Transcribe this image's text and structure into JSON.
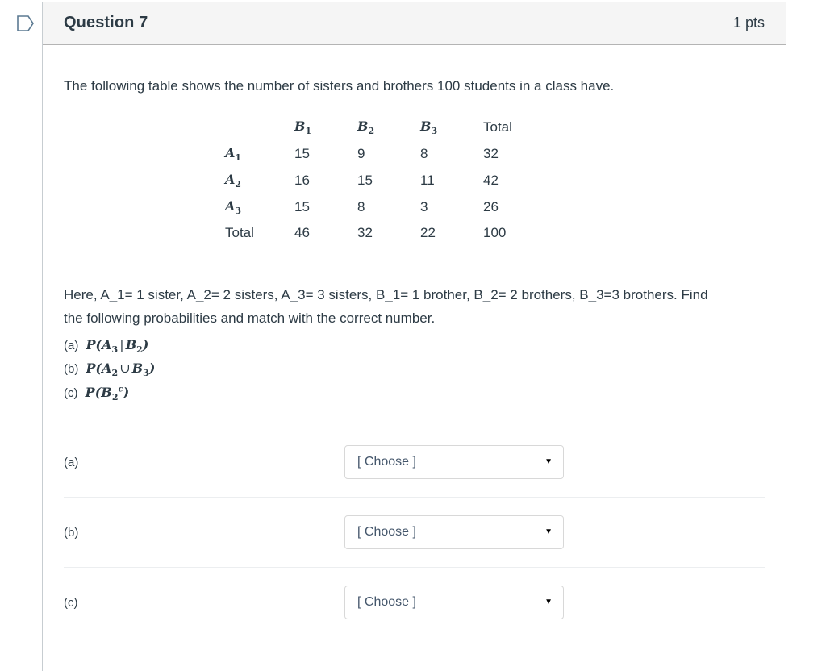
{
  "header": {
    "title": "Question 7",
    "points": "1 pts",
    "flag_icon": "flag-icon"
  },
  "body": {
    "intro": "The following table shows the number of sisters and brothers 100 students in a class have.",
    "explanation": "Here, A_1= 1 sister, A_2= 2 sisters, A_3= 3 sisters, B_1= 1 brother, B_2= 2 brothers, B_3=3 brothers.  Find the following probabilities and match with the correct number."
  },
  "table": {
    "column_headers": [
      "",
      "B",
      "B",
      "B",
      "Total"
    ],
    "column_header_subs": [
      "",
      "1",
      "2",
      "3",
      ""
    ],
    "rows": [
      {
        "label": "A",
        "sub": "1",
        "values": [
          "15",
          "9",
          "8",
          "32"
        ]
      },
      {
        "label": "A",
        "sub": "2",
        "values": [
          "16",
          "15",
          "11",
          "42"
        ]
      },
      {
        "label": "A",
        "sub": "3",
        "values": [
          "15",
          "8",
          "3",
          "26"
        ]
      },
      {
        "label": "Total",
        "sub": "",
        "values": [
          "46",
          "32",
          "22",
          "100"
        ]
      }
    ]
  },
  "probabilities": [
    {
      "marker": "(a)",
      "p": "P",
      "open": "(",
      "first": "A",
      "first_sub": "3",
      "operator": "|",
      "second": "B",
      "second_sub": "2",
      "sup": "",
      "close": ")"
    },
    {
      "marker": "(b)",
      "p": "P",
      "open": "(",
      "first": "A",
      "first_sub": "2",
      "operator": "∪",
      "second": "B",
      "second_sub": "3",
      "sup": "",
      "close": ")"
    },
    {
      "marker": "(c)",
      "p": "P",
      "open": "(",
      "first": "B",
      "first_sub": "2",
      "operator": "",
      "second": "",
      "second_sub": "",
      "sup": "c",
      "close": ")"
    }
  ],
  "answers": [
    {
      "label": "(a)",
      "value": "[ Choose ]",
      "caret": "▼"
    },
    {
      "label": "(b)",
      "value": "[ Choose ]",
      "caret": "▼"
    },
    {
      "label": "(c)",
      "value": "[ Choose ]",
      "caret": "▼"
    }
  ],
  "colors": {
    "text": "#2d3b45",
    "header_bg": "#f5f5f5",
    "border": "#c7cdd1",
    "divider": "#eceef0",
    "flag_outline": "#5c7a92"
  }
}
